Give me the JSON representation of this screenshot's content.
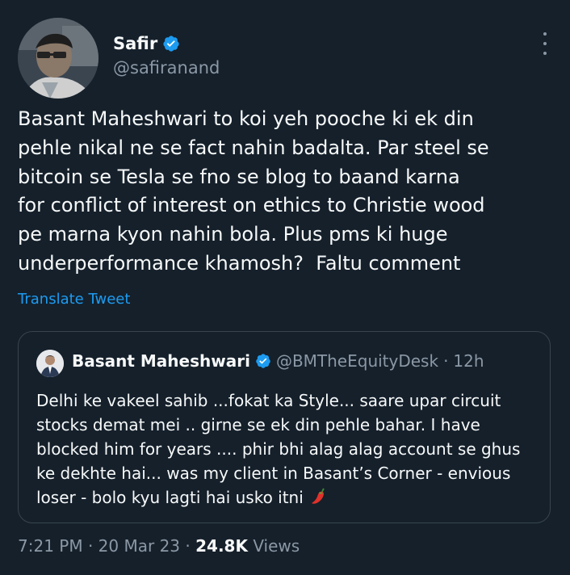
{
  "author": {
    "name": "Safir",
    "handle": "@safiranand"
  },
  "tweet": {
    "lines": [
      "Basant Maheshwari to koi yeh pooche ki ek din",
      "pehle nikal ne se fact nahin badalta. Par steel se",
      "bitcoin se Tesla se fno se blog to baand karna",
      "for conflict of interest on ethics to Christie wood",
      "pe marna kyon nahin bola. Plus pms ki huge",
      "underperformance khamosh?  Faltu comment"
    ],
    "translate_label": "Translate Tweet"
  },
  "quoted": {
    "name": "Basant Maheshwari",
    "handle": "@BMTheEquityDesk",
    "separator": "·",
    "time": "12h",
    "lines": [
      "Delhi ke vakeel sahib ...fokat ka Style... saare upar circuit",
      "stocks demat mei .. girne se ek din pehle bahar. I have",
      "blocked him for years .... phir bhi alag alag account se ghus",
      "ke dekhte hai... was my client in Basant’s Corner - envious",
      "loser - bolo kyu lagti hai usko itni"
    ],
    "emoji": "chili-pepper-icon"
  },
  "footer": {
    "time": "7:21 PM",
    "sep1": "·",
    "date": "20 Mar 23",
    "sep2": "·",
    "views_count": "24.8K",
    "views_label": "Views"
  },
  "colors": {
    "background": "#15202b",
    "text": "#f7f9f9",
    "secondary": "#8b98a5",
    "accent": "#1d9bf0",
    "border": "#38444d"
  }
}
